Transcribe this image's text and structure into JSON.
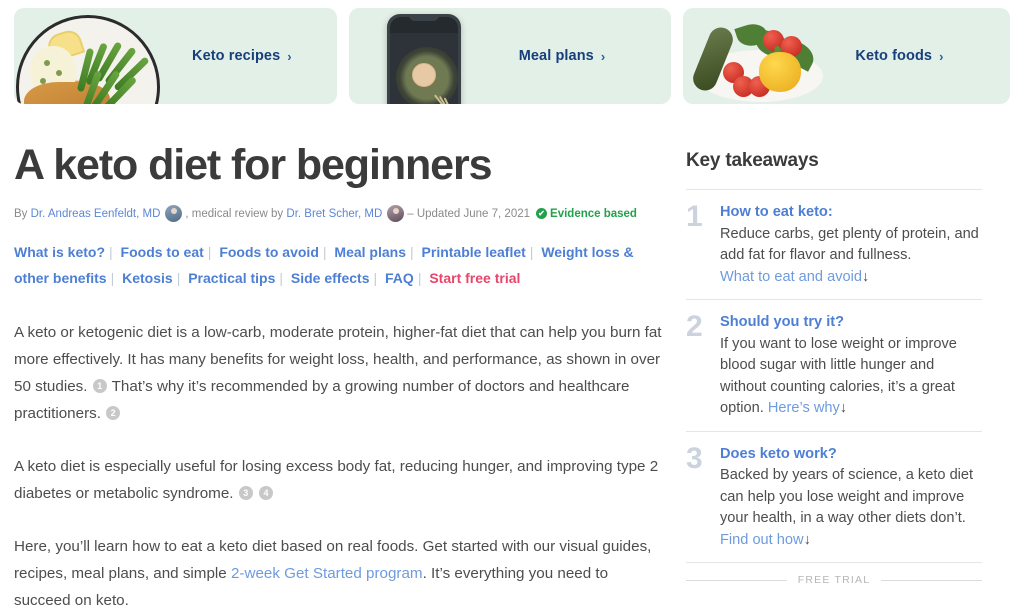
{
  "cards": [
    {
      "label": "Keto recipes",
      "chevron": "›",
      "image_alt": "plate-of-schnitzel-and-green-beans"
    },
    {
      "label": "Meal plans",
      "chevron": "›",
      "image_alt": "phone-showing-stir-fry-bowl"
    },
    {
      "label": "Keto foods",
      "chevron": "›",
      "image_alt": "fresh-vegetables-zucchini-tomatoes-pepper"
    }
  ],
  "article": {
    "headline": "A keto diet for beginners",
    "byline": {
      "by_label": "By",
      "author": "Dr. Andreas Eenfeldt, MD",
      "review_label": ", medical review by",
      "reviewer": "Dr. Bret Scher, MD",
      "updated": "– Updated June 7, 2021",
      "evidence_label": "Evidence based",
      "evidence_check": "✔"
    },
    "nav_links": [
      {
        "label": "What is keto?",
        "accent": false
      },
      {
        "label": "Foods to eat",
        "accent": false
      },
      {
        "label": "Foods to avoid",
        "accent": false
      },
      {
        "label": "Meal plans",
        "accent": false
      },
      {
        "label": "Printable leaflet",
        "accent": false
      },
      {
        "label": "Weight loss & other benefits",
        "accent": false
      },
      {
        "label": "Ketosis",
        "accent": false
      },
      {
        "label": "Practical tips",
        "accent": false
      },
      {
        "label": "Side effects",
        "accent": false
      },
      {
        "label": "FAQ",
        "accent": false
      },
      {
        "label": "Start free trial",
        "accent": true
      }
    ],
    "separator": "|",
    "paragraphs": {
      "p1_a": "A keto or ketogenic diet is a low-carb, moderate protein, higher-fat diet that can help you burn fat more effectively. It has many benefits for weight loss, health, and performance, as shown in over 50 studies.",
      "p1_cite1": "1",
      "p1_b": "That’s why it’s recommended by a growing number of doctors and healthcare practitioners.",
      "p1_cite2": "2",
      "p2_a": "A keto diet is especially useful for losing excess body fat, reducing hunger, and improving type 2 diabetes or metabolic syndrome.",
      "p2_cite3": "3",
      "p2_cite4": "4",
      "p3_a": "Here, you’ll learn how to eat a keto diet based on real foods. Get started with our visual guides, recipes, meal plans, and simple",
      "p3_link": "2-week Get Started program",
      "p3_b": ". It’s everything you need to succeed on keto."
    }
  },
  "sidebar": {
    "title": "Key takeaways",
    "takeaways": [
      {
        "number": "1",
        "heading": "How to eat keto:",
        "text": "Reduce carbs, get plenty of protein, and add fat for flavor and fullness. ",
        "link": "What to eat and avoid",
        "arrow": "↓"
      },
      {
        "number": "2",
        "heading": "Should you try it?",
        "text": "If you want to lose weight or improve blood sugar with little hunger and without counting calories, it’s a great option. ",
        "link": "Here’s why",
        "arrow": "↓"
      },
      {
        "number": "3",
        "heading": "Does keto work?",
        "text": "Backed by years of science, a keto diet can help you lose weight and improve your health, in a way other diets don’t. ",
        "link": "Find out how",
        "arrow": "↓"
      }
    ],
    "trial_divider_label": "FREE TRIAL"
  },
  "colors": {
    "card_bg": "#e3f0e7",
    "card_text": "#173f7c",
    "link_blue": "#4d7fd4",
    "soft_link_blue": "#6e9bdd",
    "accent_pink": "#e8456b",
    "evidence_green": "#21a24a",
    "numeral_gray": "#ccd3de",
    "body_text": "#4d4d4d",
    "heading_text": "#3b3b3b",
    "rule_gray": "#e6e6e6"
  }
}
